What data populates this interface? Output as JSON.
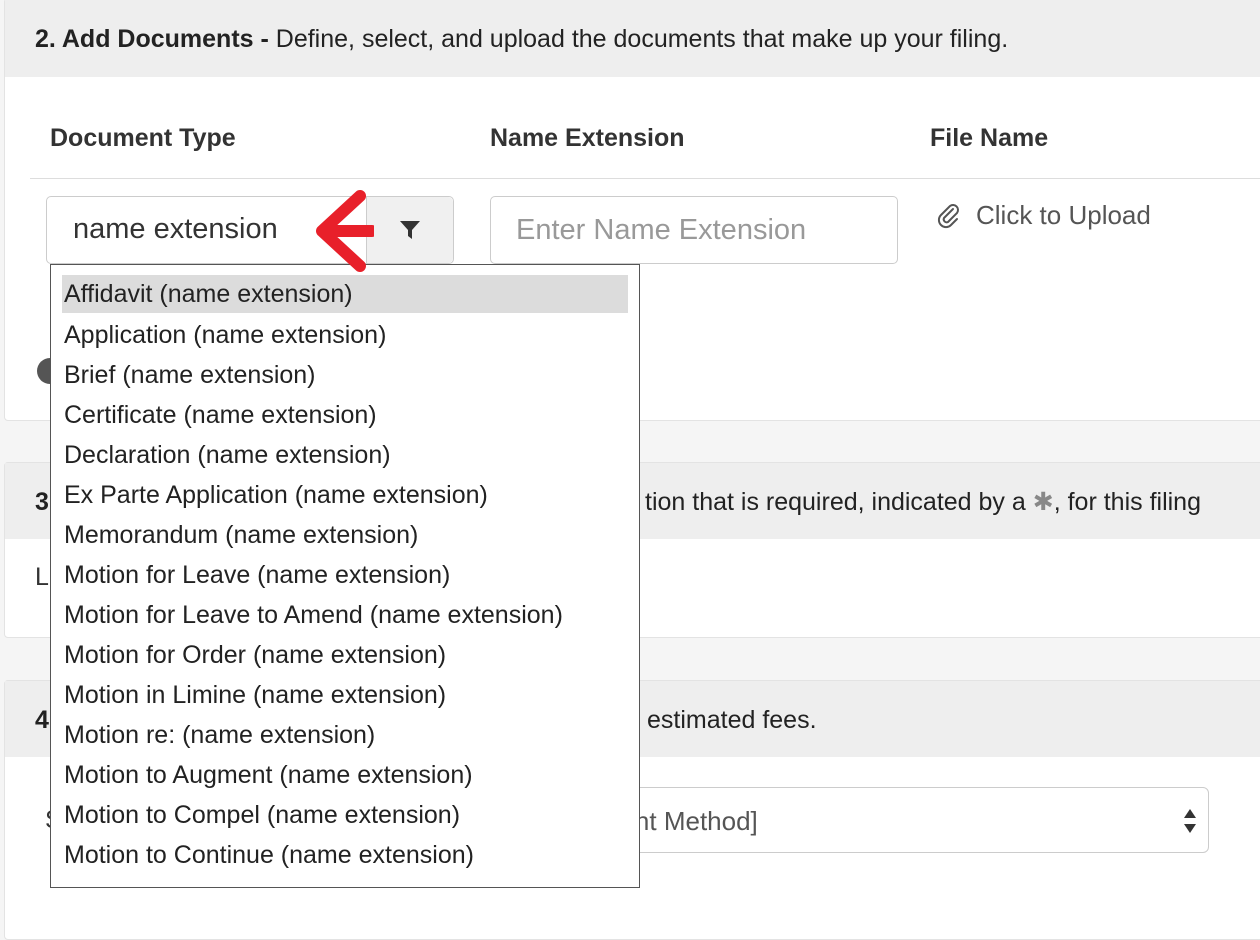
{
  "section2": {
    "number_title": "2. Add Documents -",
    "description": "Define, select, and upload the documents that make up your filing.",
    "columns": {
      "document_type": "Document Type",
      "name_extension": "Name Extension",
      "file_name": "File Name"
    },
    "doc_type_value": "name extension",
    "name_ext_placeholder": "Enter Name Extension",
    "upload_label": "Click to Upload"
  },
  "section3": {
    "number": "3",
    "text_before": "tion that is required, indicated by a",
    "star": "✱",
    "text_after": ", for this filing",
    "body_partial": "L"
  },
  "section4": {
    "number": "4",
    "text": "estimated fees.",
    "label_partial": "S",
    "payment_select_partial": "nent Method]"
  },
  "dropdown": {
    "highlighted": "Affidavit (name extension)",
    "items": [
      "Affidavit (name extension)",
      "Application (name extension)",
      "Brief (name extension)",
      "Certificate (name extension)",
      "Declaration (name extension)",
      "Ex Parte Application (name extension)",
      "Memorandum (name extension)",
      "Motion for Leave (name extension)",
      "Motion for Leave to Amend (name extension)",
      "Motion for Order (name extension)",
      "Motion in Limine (name extension)",
      "Motion re: (name extension)",
      "Motion to Augment (name extension)",
      "Motion to Compel (name extension)",
      "Motion to Continue (name extension)"
    ]
  },
  "colors": {
    "annotation_arrow": "#e8202a",
    "panel_header_bg": "#eeeeee",
    "highlight_bg": "#dcdcdc"
  },
  "icons": {
    "filter": "filter-icon",
    "paperclip": "paperclip-icon",
    "remove": "remove-icon",
    "select_arrows": "select-arrows-icon",
    "annotation": "red-arrow-icon"
  }
}
